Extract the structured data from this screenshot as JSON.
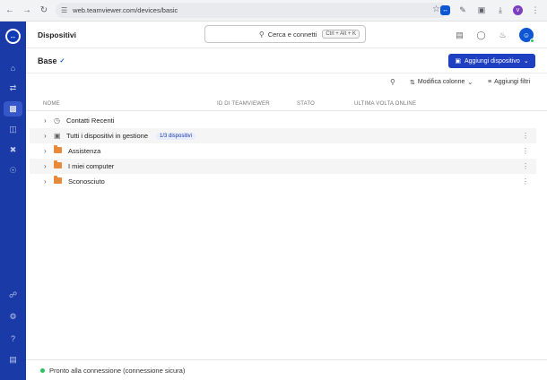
{
  "browser": {
    "url": "web.teamviewer.com/devices/basic",
    "profile_initial": "v"
  },
  "app": {
    "title": "Dispositivi",
    "search_label": "Cerca e connetti",
    "search_shortcut": "Ctrl + Alt + K",
    "user_initial": "☺"
  },
  "section": {
    "group_title": "Base",
    "add_device_label": "Aggiungi dispositivo"
  },
  "toolbar": {
    "edit_columns_label": "Modifica colonne",
    "add_filters_label": "Aggiungi filtri"
  },
  "table": {
    "columns": [
      "NOME",
      "ID DI TEAMVIEWER",
      "STATO",
      "ULTIMA VOLTA ONLINE"
    ],
    "rows": [
      {
        "label": "Contatti Recenti",
        "icon": "clock-icon"
      },
      {
        "label": "Tutti i dispositivi in gestione",
        "icon": "managed-devices-icon",
        "badge": "1/3 dispositivi"
      },
      {
        "label": "Assistenza",
        "icon": "folder-icon"
      },
      {
        "label": "I miei computer",
        "icon": "folder-icon"
      },
      {
        "label": "Sconosciuto",
        "icon": "folder-icon"
      }
    ]
  },
  "status": {
    "text": "Pronto alla connessione (connessione sicura)",
    "color": "#2ec35c"
  },
  "colors": {
    "rail": "#1a3aa8",
    "primary": "#1e3fbf",
    "folder": "#e98a3a"
  }
}
